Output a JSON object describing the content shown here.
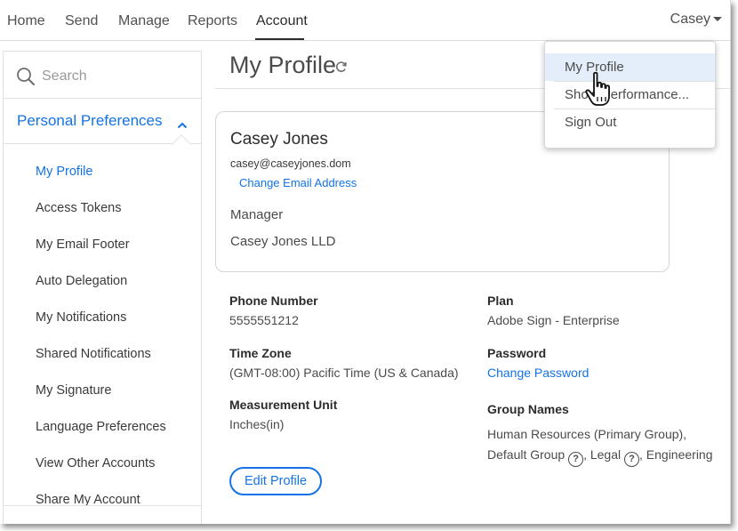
{
  "nav": {
    "items": [
      "Home",
      "Send",
      "Manage",
      "Reports",
      "Account"
    ],
    "active": "Account",
    "user": "Casey"
  },
  "sidebar": {
    "search_placeholder": "Search",
    "section": "Personal Preferences",
    "items": [
      "My Profile",
      "Access Tokens",
      "My Email Footer",
      "Auto Delegation",
      "My Notifications",
      "Shared Notifications",
      "My Signature",
      "Language Preferences",
      "View Other Accounts",
      "Share My Account"
    ],
    "active_item": "My Profile"
  },
  "main": {
    "title": "My Profile",
    "card": {
      "name": "Casey Jones",
      "email": "casey@caseyjones.dom",
      "change_email": "Change Email Address",
      "job_title": "Manager",
      "company": "Casey Jones LLD"
    },
    "fields": {
      "phone_label": "Phone Number",
      "phone_value": "5555551212",
      "timezone_label": "Time Zone",
      "timezone_value": "(GMT-08:00) Pacific Time (US & Canada)",
      "unit_label": "Measurement Unit",
      "unit_value": "Inches(in)",
      "plan_label": "Plan",
      "plan_value": "Adobe Sign - Enterprise",
      "password_label": "Password",
      "password_link": "Change Password",
      "groups_label": "Group Names",
      "groups_part1": "Human Resources (Primary Group), Default Group",
      "groups_part2": ", Legal",
      "groups_part3": ", Engineering"
    },
    "edit_button": "Edit Profile"
  },
  "dropdown": {
    "items": [
      "My Profile",
      "Show Performance...",
      "Sign Out"
    ],
    "hovered": "My Profile"
  },
  "colors": {
    "accent": "#1473e6",
    "hover_bg": "#e4eefa"
  },
  "icons": {
    "search": "search-icon",
    "refresh": "refresh-icon",
    "chevron": "chevron-up-icon",
    "help": "help-icon",
    "cursor": "hand-cursor-icon"
  }
}
